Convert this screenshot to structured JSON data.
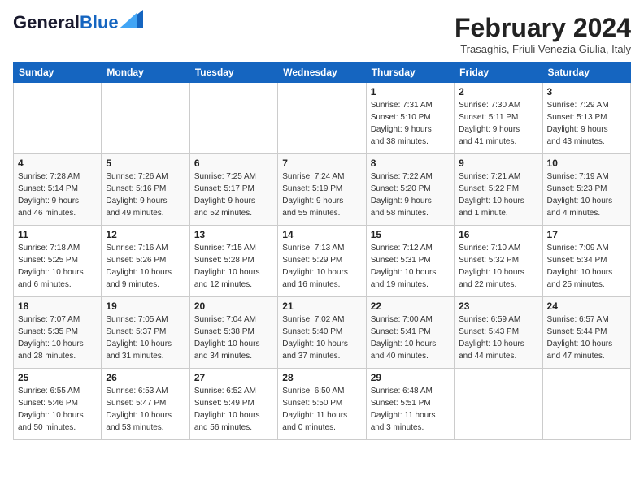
{
  "header": {
    "logo_line1": "General",
    "logo_line2": "Blue",
    "month_year": "February 2024",
    "location": "Trasaghis, Friuli Venezia Giulia, Italy"
  },
  "days_of_week": [
    "Sunday",
    "Monday",
    "Tuesday",
    "Wednesday",
    "Thursday",
    "Friday",
    "Saturday"
  ],
  "weeks": [
    [
      {
        "day": "",
        "info": ""
      },
      {
        "day": "",
        "info": ""
      },
      {
        "day": "",
        "info": ""
      },
      {
        "day": "",
        "info": ""
      },
      {
        "day": "1",
        "info": "Sunrise: 7:31 AM\nSunset: 5:10 PM\nDaylight: 9 hours\nand 38 minutes."
      },
      {
        "day": "2",
        "info": "Sunrise: 7:30 AM\nSunset: 5:11 PM\nDaylight: 9 hours\nand 41 minutes."
      },
      {
        "day": "3",
        "info": "Sunrise: 7:29 AM\nSunset: 5:13 PM\nDaylight: 9 hours\nand 43 minutes."
      }
    ],
    [
      {
        "day": "4",
        "info": "Sunrise: 7:28 AM\nSunset: 5:14 PM\nDaylight: 9 hours\nand 46 minutes."
      },
      {
        "day": "5",
        "info": "Sunrise: 7:26 AM\nSunset: 5:16 PM\nDaylight: 9 hours\nand 49 minutes."
      },
      {
        "day": "6",
        "info": "Sunrise: 7:25 AM\nSunset: 5:17 PM\nDaylight: 9 hours\nand 52 minutes."
      },
      {
        "day": "7",
        "info": "Sunrise: 7:24 AM\nSunset: 5:19 PM\nDaylight: 9 hours\nand 55 minutes."
      },
      {
        "day": "8",
        "info": "Sunrise: 7:22 AM\nSunset: 5:20 PM\nDaylight: 9 hours\nand 58 minutes."
      },
      {
        "day": "9",
        "info": "Sunrise: 7:21 AM\nSunset: 5:22 PM\nDaylight: 10 hours\nand 1 minute."
      },
      {
        "day": "10",
        "info": "Sunrise: 7:19 AM\nSunset: 5:23 PM\nDaylight: 10 hours\nand 4 minutes."
      }
    ],
    [
      {
        "day": "11",
        "info": "Sunrise: 7:18 AM\nSunset: 5:25 PM\nDaylight: 10 hours\nand 6 minutes."
      },
      {
        "day": "12",
        "info": "Sunrise: 7:16 AM\nSunset: 5:26 PM\nDaylight: 10 hours\nand 9 minutes."
      },
      {
        "day": "13",
        "info": "Sunrise: 7:15 AM\nSunset: 5:28 PM\nDaylight: 10 hours\nand 12 minutes."
      },
      {
        "day": "14",
        "info": "Sunrise: 7:13 AM\nSunset: 5:29 PM\nDaylight: 10 hours\nand 16 minutes."
      },
      {
        "day": "15",
        "info": "Sunrise: 7:12 AM\nSunset: 5:31 PM\nDaylight: 10 hours\nand 19 minutes."
      },
      {
        "day": "16",
        "info": "Sunrise: 7:10 AM\nSunset: 5:32 PM\nDaylight: 10 hours\nand 22 minutes."
      },
      {
        "day": "17",
        "info": "Sunrise: 7:09 AM\nSunset: 5:34 PM\nDaylight: 10 hours\nand 25 minutes."
      }
    ],
    [
      {
        "day": "18",
        "info": "Sunrise: 7:07 AM\nSunset: 5:35 PM\nDaylight: 10 hours\nand 28 minutes."
      },
      {
        "day": "19",
        "info": "Sunrise: 7:05 AM\nSunset: 5:37 PM\nDaylight: 10 hours\nand 31 minutes."
      },
      {
        "day": "20",
        "info": "Sunrise: 7:04 AM\nSunset: 5:38 PM\nDaylight: 10 hours\nand 34 minutes."
      },
      {
        "day": "21",
        "info": "Sunrise: 7:02 AM\nSunset: 5:40 PM\nDaylight: 10 hours\nand 37 minutes."
      },
      {
        "day": "22",
        "info": "Sunrise: 7:00 AM\nSunset: 5:41 PM\nDaylight: 10 hours\nand 40 minutes."
      },
      {
        "day": "23",
        "info": "Sunrise: 6:59 AM\nSunset: 5:43 PM\nDaylight: 10 hours\nand 44 minutes."
      },
      {
        "day": "24",
        "info": "Sunrise: 6:57 AM\nSunset: 5:44 PM\nDaylight: 10 hours\nand 47 minutes."
      }
    ],
    [
      {
        "day": "25",
        "info": "Sunrise: 6:55 AM\nSunset: 5:46 PM\nDaylight: 10 hours\nand 50 minutes."
      },
      {
        "day": "26",
        "info": "Sunrise: 6:53 AM\nSunset: 5:47 PM\nDaylight: 10 hours\nand 53 minutes."
      },
      {
        "day": "27",
        "info": "Sunrise: 6:52 AM\nSunset: 5:49 PM\nDaylight: 10 hours\nand 56 minutes."
      },
      {
        "day": "28",
        "info": "Sunrise: 6:50 AM\nSunset: 5:50 PM\nDaylight: 11 hours\nand 0 minutes."
      },
      {
        "day": "29",
        "info": "Sunrise: 6:48 AM\nSunset: 5:51 PM\nDaylight: 11 hours\nand 3 minutes."
      },
      {
        "day": "",
        "info": ""
      },
      {
        "day": "",
        "info": ""
      }
    ]
  ]
}
